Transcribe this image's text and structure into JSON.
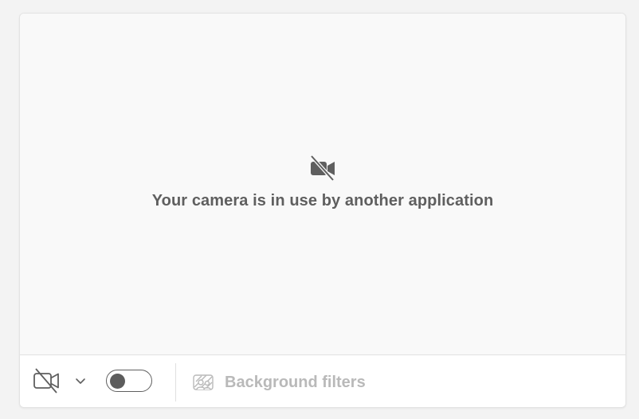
{
  "preview": {
    "status_icon": "camera-off-filled-icon",
    "message": "Your camera is in use by another application"
  },
  "toolbar": {
    "camera_toggle_icon": "camera-off-icon",
    "camera_dropdown_icon": "chevron-down-icon",
    "switch_state": "off",
    "background_filters_icon": "background-filters-icon",
    "background_filters_label": "Background filters"
  },
  "colors": {
    "page_background": "#f3f3f3",
    "preview_background": "#f9f9f9",
    "toolbar_background": "#ffffff",
    "message_text": "#5f5f5f",
    "disabled_text": "#b9b9b9",
    "icon": "#5f5f5f"
  }
}
